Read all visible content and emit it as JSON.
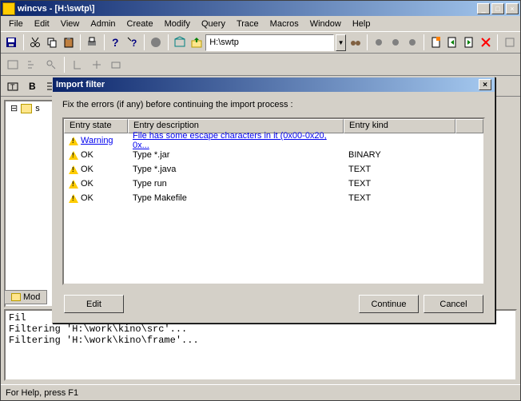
{
  "window": {
    "title": "wincvs - [H:\\swtp\\]",
    "path_value": "H:\\swtp"
  },
  "menu": [
    "File",
    "Edit",
    "View",
    "Admin",
    "Create",
    "Modify",
    "Query",
    "Trace",
    "Macros",
    "Window",
    "Help"
  ],
  "tree": {
    "root_label": "s"
  },
  "tabs": {
    "modules": "Mod"
  },
  "output": {
    "line1": "Fil",
    "line2": "Filtering 'H:\\work\\kino\\src'...",
    "line3": "Filtering 'H:\\work\\kino\\frame'..."
  },
  "statusbar": "For Help, press F1",
  "dialog": {
    "title": "Import filter",
    "message": "Fix the errors (if any) before continuing the import process :",
    "columns": {
      "state": "Entry state",
      "desc": "Entry description",
      "kind": "Entry kind"
    },
    "rows": [
      {
        "state": "Warning",
        "desc": "File has some escape characters in it (0x00-0x20, 0x...",
        "kind": "",
        "link": true
      },
      {
        "state": "OK",
        "desc": "Type *.jar",
        "kind": "BINARY",
        "link": false
      },
      {
        "state": "OK",
        "desc": "Type *.java",
        "kind": "TEXT",
        "link": false
      },
      {
        "state": "OK",
        "desc": "Type run",
        "kind": "TEXT",
        "link": false
      },
      {
        "state": "OK",
        "desc": "Type Makefile",
        "kind": "TEXT",
        "link": false
      }
    ],
    "buttons": {
      "edit": "Edit",
      "continue": "Continue",
      "cancel": "Cancel"
    }
  }
}
